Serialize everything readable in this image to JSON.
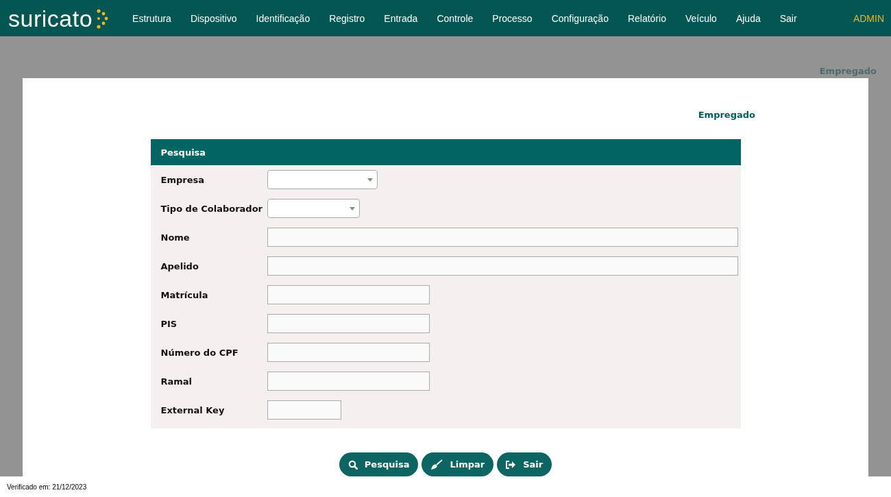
{
  "header": {
    "logo": "suricato",
    "menu": [
      "Estrutura",
      "Dispositivo",
      "Identificação",
      "Registro",
      "Entrada",
      "Controle",
      "Processo",
      "Configuração",
      "Relatório",
      "Veículo",
      "Ajuda",
      "Sair"
    ],
    "user": "ADMIN"
  },
  "breadcrumb": "Empregado",
  "page_title": "Empregado",
  "panel": {
    "title": "Pesquisa",
    "fields": [
      {
        "label": "Empresa",
        "kind": "select"
      },
      {
        "label": "Tipo de Colaborador",
        "kind": "select"
      },
      {
        "label": "Nome",
        "kind": "text"
      },
      {
        "label": "Apelido",
        "kind": "text"
      },
      {
        "label": "Matrícula",
        "kind": "text"
      },
      {
        "label": "PIS",
        "kind": "text"
      },
      {
        "label": "Número do CPF",
        "kind": "text"
      },
      {
        "label": "Ramal",
        "kind": "text"
      },
      {
        "label": "External Key",
        "kind": "text"
      }
    ]
  },
  "buttons": [
    {
      "label": "Pesquisa"
    },
    {
      "label": "Limpar"
    },
    {
      "label": "Sair"
    }
  ],
  "footer": "Verificado em: 21/12/2023"
}
